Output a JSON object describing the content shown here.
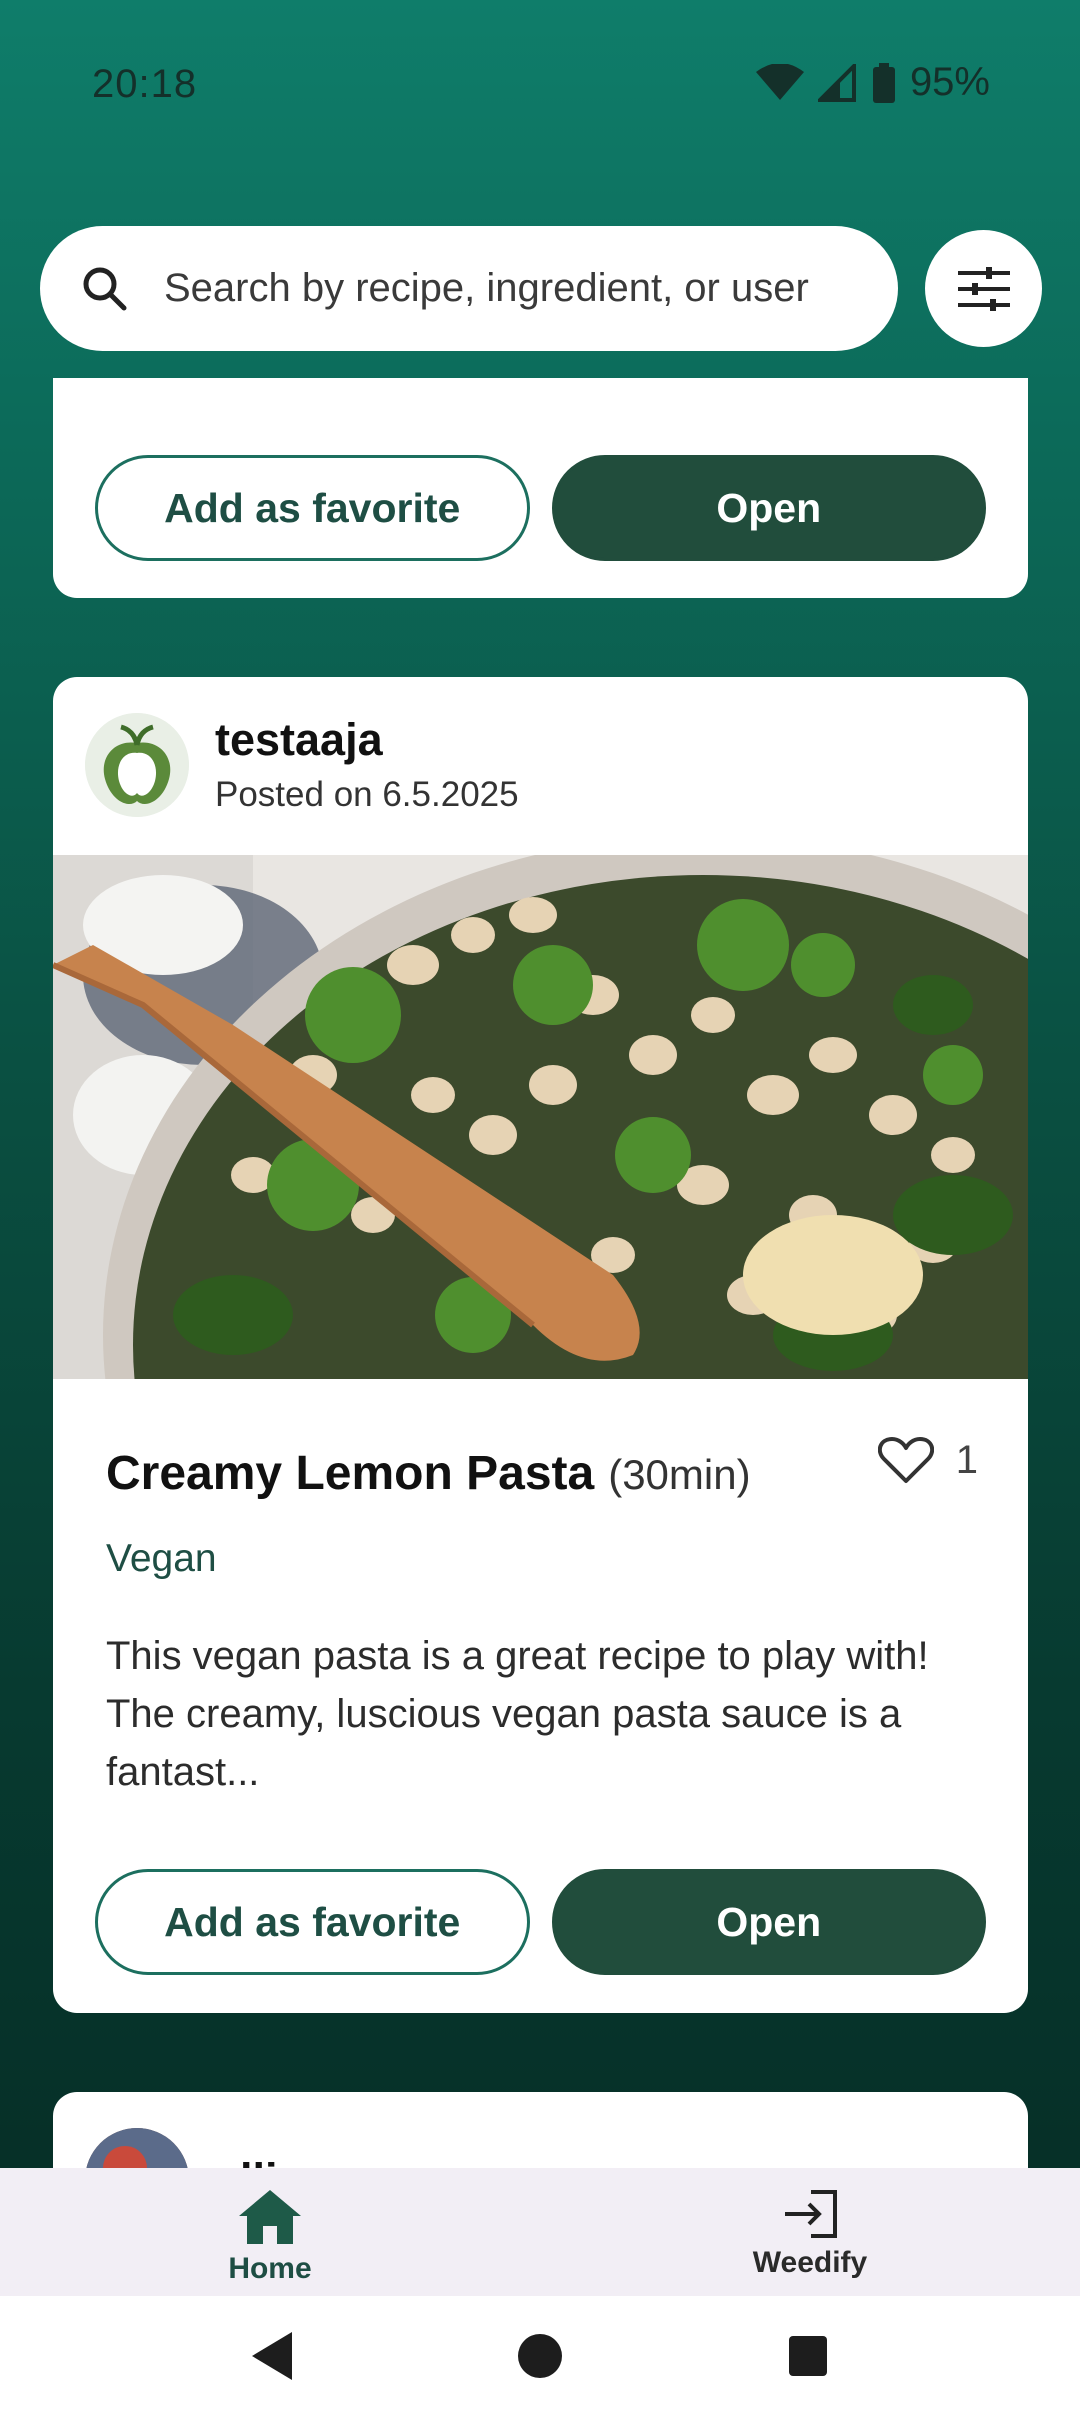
{
  "status": {
    "time": "20:18",
    "battery": "95%"
  },
  "search": {
    "placeholder": "Search by recipe, ingredient, or user"
  },
  "colors": {
    "brand_dark": "#214d3c",
    "accent": "#1c6f5f",
    "background_top": "#0f7d6a",
    "background_bottom": "#052a23"
  },
  "cards": [
    {
      "actions": {
        "favorite_label": "Add as favorite",
        "open_label": "Open"
      }
    },
    {
      "author": {
        "name": "testaaja",
        "posted": "Posted on 6.5.2025",
        "avatar_icon": "pepper-logo-avatar"
      },
      "title": "Creamy Lemon Pasta",
      "time": "(30min)",
      "likes": "1",
      "tag": "Vegan",
      "description": "This vegan pasta is a great recipe to play with! The creamy, luscious vegan pasta sauce is a fantast...",
      "actions": {
        "favorite_label": "Add as favorite",
        "open_label": "Open"
      }
    },
    {
      "author": {
        "name": "elli"
      }
    }
  ],
  "bottom_nav": {
    "items": [
      {
        "label": "Home",
        "icon": "home-icon",
        "active": true
      },
      {
        "label": "Weedify",
        "icon": "login-icon",
        "active": false
      }
    ]
  }
}
